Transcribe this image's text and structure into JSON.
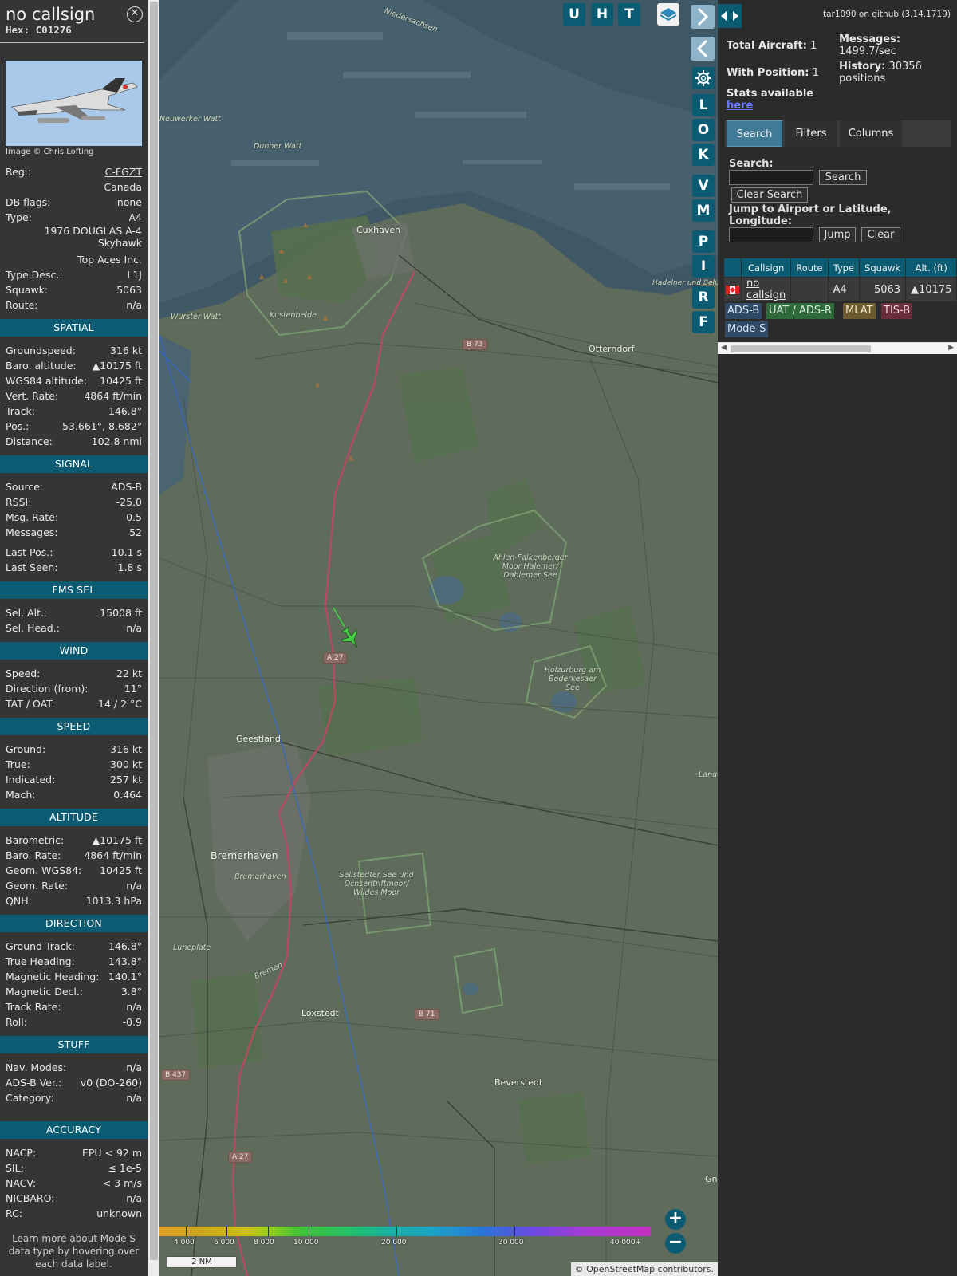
{
  "info": {
    "callsign": "no callsign",
    "hex_label": "Hex:",
    "hex": "C01276",
    "photo_credit": "Image © Chris Lofting",
    "rows_top": [
      {
        "k": "Reg.:",
        "v": "C-FGZT",
        "link": true
      },
      {
        "k": "",
        "v": "Canada"
      },
      {
        "k": "DB flags:",
        "v": "none"
      },
      {
        "k": "Type:",
        "v": "A4"
      },
      {
        "k": "",
        "v": "1976 DOUGLAS A-4 Skyhawk"
      },
      {
        "k": "",
        "v": "Top Aces Inc."
      },
      {
        "k": "Type Desc.:",
        "v": "L1J"
      },
      {
        "k": "Squawk:",
        "v": "5063"
      },
      {
        "k": "Route:",
        "v": "n/a"
      }
    ],
    "sections": [
      {
        "title": "SPATIAL",
        "rows": [
          {
            "k": "Groundspeed:",
            "v": "316 kt"
          },
          {
            "k": "Baro. altitude:",
            "v": "▲10175 ft"
          },
          {
            "k": "WGS84 altitude:",
            "v": "10425 ft"
          },
          {
            "k": "Vert. Rate:",
            "v": "4864 ft/min"
          },
          {
            "k": "Track:",
            "v": "146.8°"
          },
          {
            "k": "Pos.:",
            "v": "53.661°, 8.682°"
          },
          {
            "k": "Distance:",
            "v": "102.8 nmi"
          }
        ]
      },
      {
        "title": "SIGNAL",
        "rows": [
          {
            "k": "Source:",
            "v": "ADS-B"
          },
          {
            "k": "RSSI:",
            "v": "-25.0"
          },
          {
            "k": "Msg. Rate:",
            "v": "0.5"
          },
          {
            "k": "Messages:",
            "v": "52"
          },
          {
            "gap": true
          },
          {
            "k": "Last Pos.:",
            "v": "10.1 s"
          },
          {
            "k": "Last Seen:",
            "v": "1.8 s"
          }
        ]
      },
      {
        "title": "FMS SEL",
        "rows": [
          {
            "k": "Sel. Alt.:",
            "v": "15008 ft"
          },
          {
            "k": "Sel. Head.:",
            "v": "n/a"
          }
        ]
      },
      {
        "title": "WIND",
        "rows": [
          {
            "k": "Speed:",
            "v": "22 kt"
          },
          {
            "k": "Direction (from):",
            "v": "11°"
          },
          {
            "k": "TAT / OAT:",
            "v": "14 / 2 °C"
          }
        ]
      },
      {
        "title": "SPEED",
        "rows": [
          {
            "k": "Ground:",
            "v": "316 kt"
          },
          {
            "k": "True:",
            "v": "300 kt"
          },
          {
            "k": "Indicated:",
            "v": "257 kt"
          },
          {
            "k": "Mach:",
            "v": "0.464"
          }
        ]
      },
      {
        "title": "ALTITUDE",
        "rows": [
          {
            "k": "Barometric:",
            "v": "▲10175 ft"
          },
          {
            "k": "Baro. Rate:",
            "v": "4864 ft/min"
          },
          {
            "k": "Geom. WGS84:",
            "v": "10425 ft"
          },
          {
            "k": "Geom. Rate:",
            "v": "n/a"
          },
          {
            "k": "QNH:",
            "v": "1013.3 hPa"
          }
        ]
      },
      {
        "title": "DIRECTION",
        "rows": [
          {
            "k": "Ground Track:",
            "v": "146.8°"
          },
          {
            "k": "True Heading:",
            "v": "143.8°"
          },
          {
            "k": "Magnetic Heading:",
            "v": "140.1°"
          },
          {
            "k": "Magnetic Decl.:",
            "v": "3.8°"
          },
          {
            "k": "Track Rate:",
            "v": "n/a"
          },
          {
            "k": "Roll:",
            "v": "-0.9"
          }
        ]
      },
      {
        "title": "STUFF",
        "rows": [
          {
            "k": "Nav. Modes:",
            "v": "n/a"
          },
          {
            "k": "ADS-B Ver.:",
            "v": "v0 (DO-260)"
          },
          {
            "k": "Category:",
            "v": "n/a"
          },
          {
            "gap": true
          },
          {
            "gap": true
          }
        ]
      },
      {
        "title": "ACCURACY",
        "rows": [
          {
            "k": "NACP:",
            "v": "EPU < 92 m"
          },
          {
            "k": "SIL:",
            "v": "≤ 1e-5"
          },
          {
            "k": "NACV:",
            "v": "< 3 m/s"
          },
          {
            "k": "NICBARO:",
            "v": "n/a"
          },
          {
            "k": "RC:",
            "v": "unknown"
          }
        ]
      }
    ],
    "learn_more": "Learn more about Mode S data type by hovering over each data label."
  },
  "map": {
    "toolbar": [
      "U",
      "H",
      "T"
    ],
    "side_buttons": [
      "L",
      "O",
      "K",
      "V",
      "M",
      "P",
      "I",
      "R",
      "F"
    ],
    "labels": {
      "cuxhaven": "Cuxhaven",
      "otterndorf": "Otterndorf",
      "geestland": "Geestland",
      "bremerhaven": "Bremerhaven",
      "bremerhaven_small": "Bremerhaven",
      "loxstedt": "Loxstedt",
      "beverstedt": "Beverstedt",
      "neuwerker": "Neuwerker Watt",
      "duhner": "Duhner Watt",
      "kustenheide": "Kustenheide",
      "wurster": "Wurster Watt",
      "niedersachsen": "Niedersachsen",
      "ahlen": "Ahlen-Falkenberger Moor Halemer/ Dahlemer See",
      "holzurburg": "Holzurburg am Bederkesaer See",
      "sellstedter": "Sellstedter See und Ochsentriftmoor/ Wildes Moor",
      "luneplate": "Luneplate",
      "bremen": "Bremen",
      "hadelner": "Hadelner und Belum Außende",
      "lange": "Lange Moo",
      "gn": "Gna"
    },
    "shields": [
      "B 73",
      "A 27",
      "B 71",
      "B 437",
      "A 27"
    ],
    "legend_labels": [
      "4 000",
      "6 000",
      "8 000",
      "10 000",
      "20 000",
      "30 000",
      "40 000+"
    ],
    "scale": "2 NM",
    "attribution": "© OpenStreetMap contributors."
  },
  "side": {
    "github": "tar1090 on github (3.14.1719)",
    "total_label": "Total Aircraft:",
    "total": "1",
    "position_label": "With Position:",
    "position": "1",
    "stats_label": "Stats available",
    "stats_link": "here",
    "messages_label": "Messages:",
    "messages": "1499.7/sec",
    "history_label": "History:",
    "history": "30356 positions",
    "tabs": [
      "Search",
      "Filters",
      "Columns"
    ],
    "search_label": "Search:",
    "search_button": "Search",
    "clear_search": "Clear Search",
    "jump_label": "Jump to Airport or Latitude, Longitude:",
    "jump_button": "Jump",
    "clear_button": "Clear",
    "table": {
      "headers": [
        "Callsign",
        "Route",
        "Type",
        "Squawk",
        "Alt. (ft)"
      ],
      "row": {
        "callsign": "no callsign",
        "route": "",
        "type": "A4",
        "squawk": "5063",
        "alt": "▲10175"
      }
    },
    "badges": [
      {
        "label": "ADS-B",
        "bg": "#2e4a66",
        "fg": "#d8e6f2"
      },
      {
        "label": "UAT / ADS-R",
        "bg": "#2f6a3a",
        "fg": "#dbeedd"
      },
      {
        "label": "MLAT",
        "bg": "#6b5a2d",
        "fg": "#f2e7c8"
      },
      {
        "label": "TIS-B",
        "bg": "#6a2e3d",
        "fg": "#f3d6dd"
      },
      {
        "label": "Mode-S",
        "bg": "#2e4a66",
        "fg": "#d8e6f2"
      }
    ]
  }
}
